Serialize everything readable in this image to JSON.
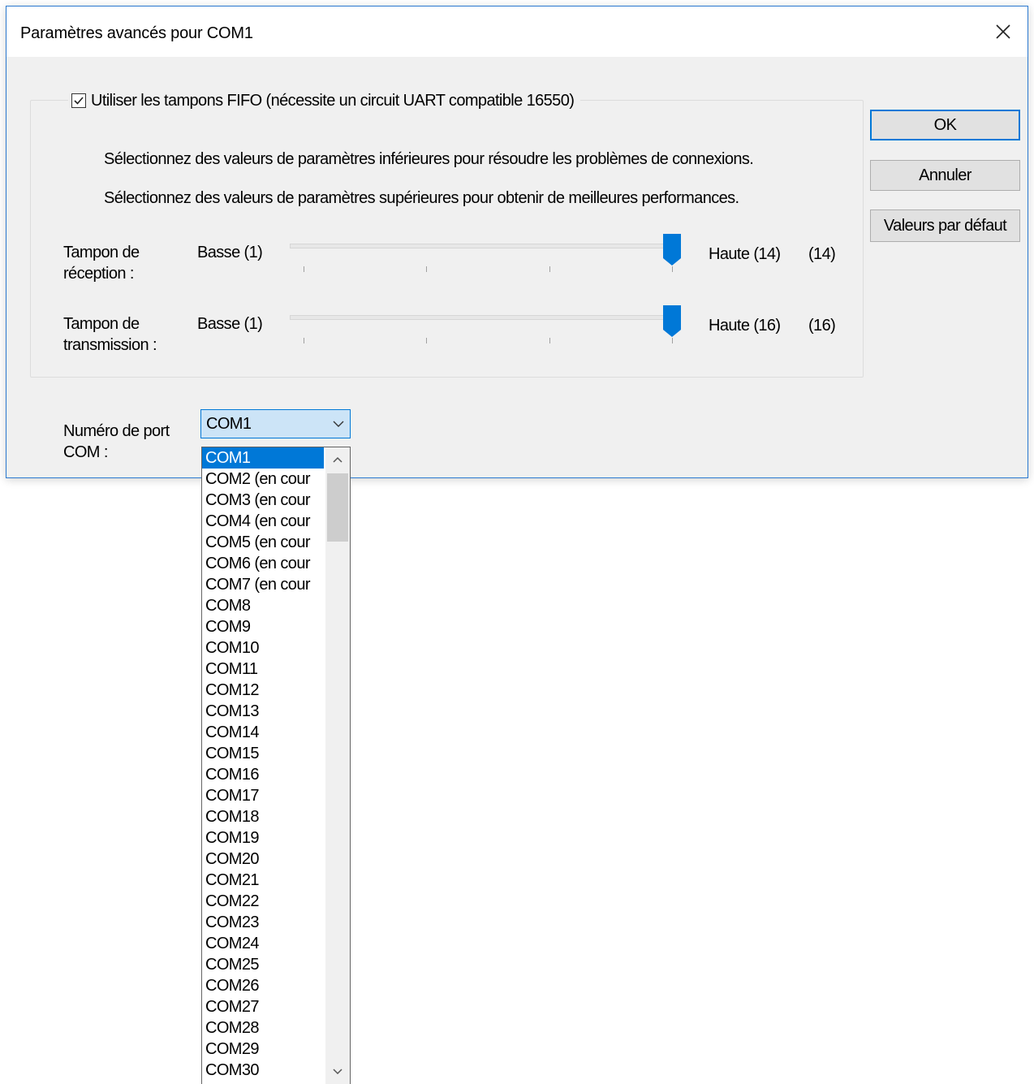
{
  "window": {
    "title": "Paramètres avancés pour COM1",
    "accent": "#0078d7",
    "close_icon": "close-icon"
  },
  "fifo": {
    "checked": true,
    "label": "Utiliser les tampons FIFO (nécessite un circuit UART compatible 16550)",
    "hint_lower": "Sélectionnez des valeurs de paramètres inférieures pour résoudre les problèmes de connexions.",
    "hint_higher": "Sélectionnez des valeurs de paramètres supérieures pour obtenir de meilleures performances."
  },
  "receive": {
    "label_line1": "Tampon de",
    "label_line2": "réception :",
    "min_label": "Basse (1)",
    "max_label": "Haute (14)",
    "value_display": "(14)",
    "min": 1,
    "max": 14,
    "value": 14
  },
  "transmit": {
    "label_line1": "Tampon de",
    "label_line2": "transmission :",
    "min_label": "Basse (1)",
    "max_label": "Haute (16)",
    "value_display": "(16)",
    "min": 1,
    "max": 16,
    "value": 16
  },
  "buttons": {
    "ok": "OK",
    "cancel": "Annuler",
    "defaults": "Valeurs par défaut"
  },
  "port": {
    "label_line1": "Numéro de port",
    "label_line2": "COM :",
    "selected": "COM1",
    "options": [
      "COM1",
      "COM2 (en cour",
      "COM3 (en cour",
      "COM4 (en cour",
      "COM5 (en cour",
      "COM6 (en cour",
      "COM7 (en cour",
      "COM8",
      "COM9",
      "COM10",
      "COM11",
      "COM12",
      "COM13",
      "COM14",
      "COM15",
      "COM16",
      "COM17",
      "COM18",
      "COM19",
      "COM20",
      "COM21",
      "COM22",
      "COM23",
      "COM24",
      "COM25",
      "COM26",
      "COM27",
      "COM28",
      "COM29",
      "COM30"
    ]
  }
}
